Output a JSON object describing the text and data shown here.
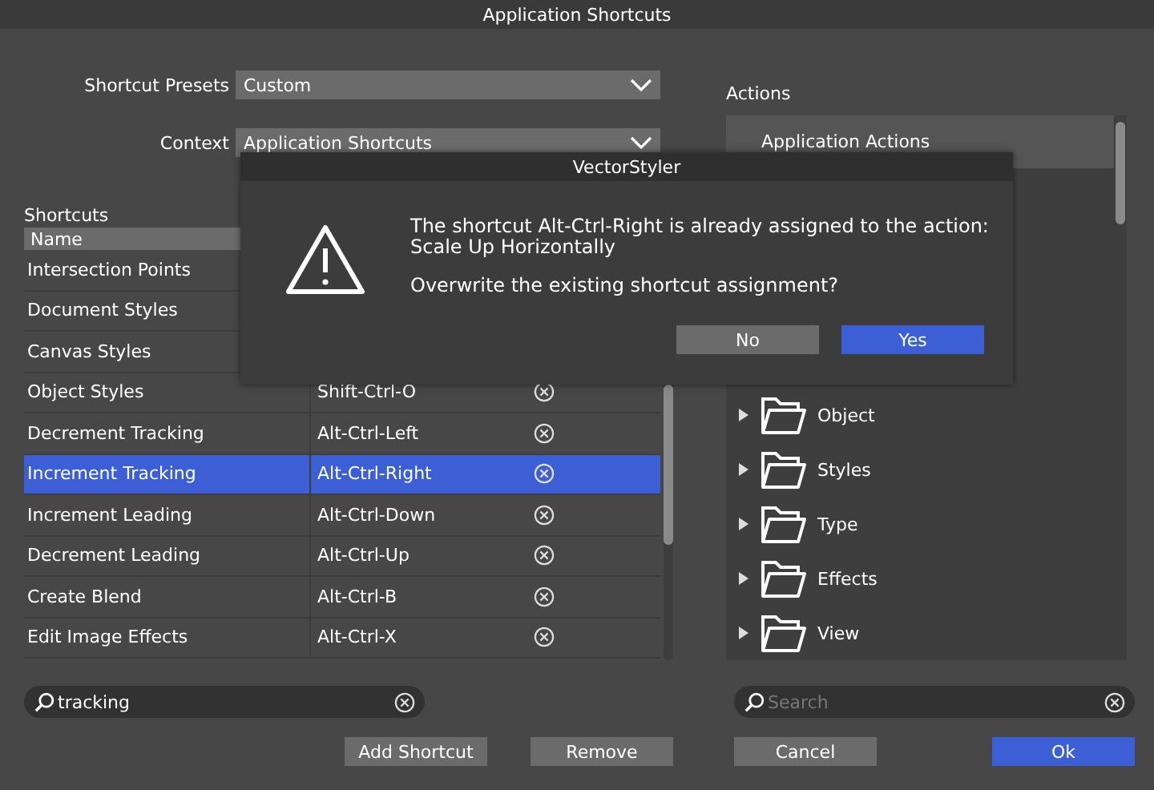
{
  "window": {
    "title": "Application Shortcuts"
  },
  "presets": {
    "label": "Shortcut Presets",
    "value": "Custom"
  },
  "context": {
    "label": "Context",
    "value": "Application Shortcuts"
  },
  "shortcuts": {
    "label": "Shortcuts",
    "columns": [
      "Name"
    ],
    "rows": [
      {
        "name": "Intersection Points",
        "selected": false
      },
      {
        "name": "Document Styles",
        "selected": false
      },
      {
        "name": "Canvas Styles",
        "selected": false
      },
      {
        "name": "Object Styles",
        "shortcut": "Shift-Ctrl-O",
        "selected": false
      },
      {
        "name": "Decrement Tracking",
        "shortcut": "Alt-Ctrl-Left",
        "selected": false
      },
      {
        "name": "Increment Tracking",
        "shortcut": "Alt-Ctrl-Right",
        "selected": true
      },
      {
        "name": "Increment Leading",
        "shortcut": "Alt-Ctrl-Down",
        "selected": false
      },
      {
        "name": "Decrement Leading",
        "shortcut": "Alt-Ctrl-Up",
        "selected": false
      },
      {
        "name": "Create Blend",
        "shortcut": "Alt-Ctrl-B",
        "selected": false
      },
      {
        "name": "Edit Image Effects",
        "shortcut": "Alt-Ctrl-X",
        "selected": false
      }
    ],
    "search": {
      "value": "tracking"
    }
  },
  "actions": {
    "label": "Actions",
    "header": "Application Actions",
    "items": [
      {
        "label": "Object",
        "expanded": false
      },
      {
        "label": "Styles",
        "expanded": false
      },
      {
        "label": "Type",
        "expanded": false
      },
      {
        "label": "Effects",
        "expanded": false
      },
      {
        "label": "View",
        "expanded": false
      }
    ],
    "search": {
      "placeholder": "Search"
    }
  },
  "left_buttons": [
    {
      "label": "Add Shortcut",
      "primary": false
    },
    {
      "label": "Remove",
      "primary": false
    }
  ],
  "right_buttons": [
    {
      "label": "Cancel",
      "primary": false
    },
    {
      "label": "Ok",
      "primary": true
    }
  ],
  "dialog": {
    "title": "VectorStyler",
    "message": "The shortcut Alt-Ctrl-Right is already assigned to the action:",
    "action": "Scale Up Horizontally",
    "question": "Overwrite the existing shortcut assignment?",
    "buttons": [
      {
        "label": "No",
        "primary": false
      },
      {
        "label": "Yes",
        "primary": true
      }
    ]
  }
}
